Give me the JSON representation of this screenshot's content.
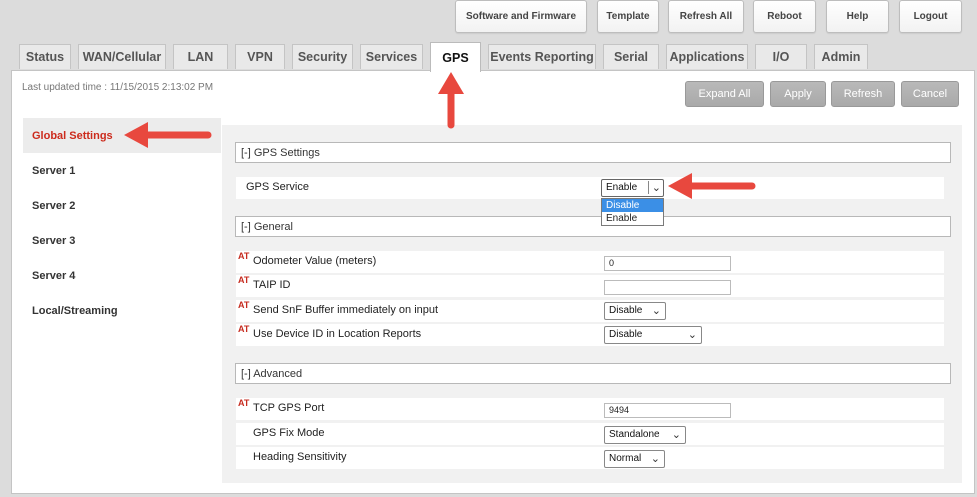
{
  "top_buttons": [
    {
      "label": "Software and Firmware"
    },
    {
      "label": "Template"
    },
    {
      "label": "Refresh All"
    },
    {
      "label": "Reboot"
    },
    {
      "label": "Help"
    },
    {
      "label": "Logout"
    }
  ],
  "tabs": [
    {
      "label": "Status"
    },
    {
      "label": "WAN/Cellular"
    },
    {
      "label": "LAN"
    },
    {
      "label": "VPN"
    },
    {
      "label": "Security"
    },
    {
      "label": "Services"
    },
    {
      "label": "GPS",
      "active": true
    },
    {
      "label": "Events Reporting"
    },
    {
      "label": "Serial"
    },
    {
      "label": "Applications"
    },
    {
      "label": "I/O"
    },
    {
      "label": "Admin"
    }
  ],
  "last_updated": "Last updated time : 11/15/2015 2:13:02 PM",
  "actions": {
    "expand_all": "Expand All",
    "apply": "Apply",
    "refresh": "Refresh",
    "cancel": "Cancel"
  },
  "sidebar": [
    {
      "label": "Global Settings",
      "active": true
    },
    {
      "label": "Server 1"
    },
    {
      "label": "Server 2"
    },
    {
      "label": "Server 3"
    },
    {
      "label": "Server 4"
    },
    {
      "label": "Local/Streaming"
    }
  ],
  "sections": {
    "gps_settings": "[-] GPS Settings",
    "general": "[-] General",
    "advanced": "[-] Advanced"
  },
  "at_marker": "AT",
  "gps_service": {
    "label": "GPS Service",
    "value": "Enable",
    "options": [
      "Disable",
      "Enable"
    ],
    "highlighted": "Disable"
  },
  "general": {
    "odometer": {
      "label": "Odometer Value (meters)",
      "value": "0"
    },
    "taip_id": {
      "label": "TAIP ID",
      "value": ""
    },
    "snf_buffer": {
      "label": "Send SnF Buffer immediately on input",
      "value": "Disable"
    },
    "device_id": {
      "label": "Use Device ID in Location Reports",
      "value": "Disable"
    }
  },
  "advanced": {
    "tcp_port": {
      "label": "TCP GPS Port",
      "value": "9494"
    },
    "fix_mode": {
      "label": "GPS Fix Mode",
      "value": "Standalone"
    },
    "heading": {
      "label": "Heading Sensitivity",
      "value": "Normal"
    }
  },
  "colors": {
    "accent_red": "#cc2a1c",
    "highlight_blue": "#3b8fe6",
    "annotation_arrow": "#e8483e"
  }
}
